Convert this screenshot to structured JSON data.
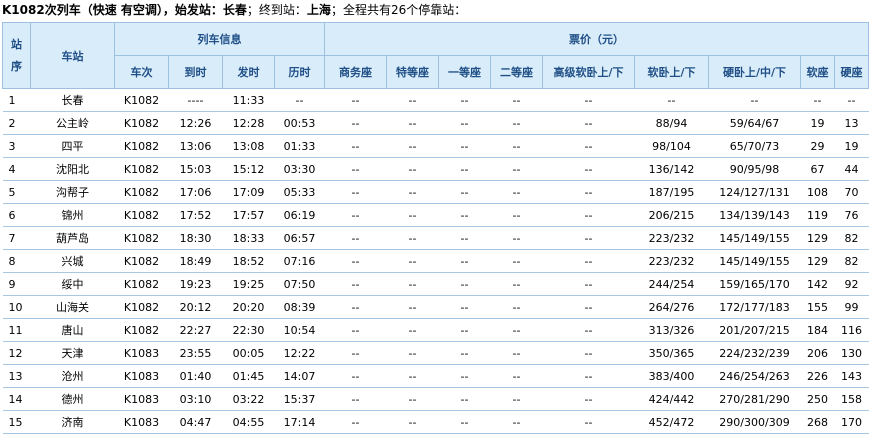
{
  "header": {
    "train_label": "K1082次列车（快速 有空调），始发站：",
    "origin": "长春",
    "terminal_label": "；终到站：",
    "terminal": "上海",
    "summary": "；全程共有26个停靠站："
  },
  "columns": {
    "seq": "站序",
    "station": "车站",
    "train_info": "列车信息",
    "fare_group": "票价（元）",
    "train_no": "车次",
    "arrive": "到时",
    "depart": "发时",
    "duration": "历时",
    "business": "商务座",
    "special": "特等座",
    "first": "一等座",
    "second": "二等座",
    "deluxe_sleeper": "高级软卧上/下",
    "soft_sleeper": "软卧上/下",
    "hard_sleeper": "硬卧上/中/下",
    "soft_seat": "软座",
    "hard_seat": "硬座"
  },
  "rows": [
    [
      "1",
      "长春",
      "K1082",
      "----",
      "11:33",
      "--",
      "--",
      "--",
      "--",
      "--",
      "--",
      "--",
      "--",
      "--",
      "--"
    ],
    [
      "2",
      "公主岭",
      "K1082",
      "12:26",
      "12:28",
      "00:53",
      "--",
      "--",
      "--",
      "--",
      "--",
      "88/94",
      "59/64/67",
      "19",
      "13"
    ],
    [
      "3",
      "四平",
      "K1082",
      "13:06",
      "13:08",
      "01:33",
      "--",
      "--",
      "--",
      "--",
      "--",
      "98/104",
      "65/70/73",
      "29",
      "19"
    ],
    [
      "4",
      "沈阳北",
      "K1082",
      "15:03",
      "15:12",
      "03:30",
      "--",
      "--",
      "--",
      "--",
      "--",
      "136/142",
      "90/95/98",
      "67",
      "44"
    ],
    [
      "5",
      "沟帮子",
      "K1082",
      "17:06",
      "17:09",
      "05:33",
      "--",
      "--",
      "--",
      "--",
      "--",
      "187/195",
      "124/127/131",
      "108",
      "70"
    ],
    [
      "6",
      "锦州",
      "K1082",
      "17:52",
      "17:57",
      "06:19",
      "--",
      "--",
      "--",
      "--",
      "--",
      "206/215",
      "134/139/143",
      "119",
      "76"
    ],
    [
      "7",
      "葫芦岛",
      "K1082",
      "18:30",
      "18:33",
      "06:57",
      "--",
      "--",
      "--",
      "--",
      "--",
      "223/232",
      "145/149/155",
      "129",
      "82"
    ],
    [
      "8",
      "兴城",
      "K1082",
      "18:49",
      "18:52",
      "07:16",
      "--",
      "--",
      "--",
      "--",
      "--",
      "223/232",
      "145/149/155",
      "129",
      "82"
    ],
    [
      "9",
      "绥中",
      "K1082",
      "19:23",
      "19:25",
      "07:50",
      "--",
      "--",
      "--",
      "--",
      "--",
      "244/254",
      "159/165/170",
      "142",
      "92"
    ],
    [
      "10",
      "山海关",
      "K1082",
      "20:12",
      "20:20",
      "08:39",
      "--",
      "--",
      "--",
      "--",
      "--",
      "264/276",
      "172/177/183",
      "155",
      "99"
    ],
    [
      "11",
      "唐山",
      "K1082",
      "22:27",
      "22:30",
      "10:54",
      "--",
      "--",
      "--",
      "--",
      "--",
      "313/326",
      "201/207/215",
      "184",
      "116"
    ],
    [
      "12",
      "天津",
      "K1083",
      "23:55",
      "00:05",
      "12:22",
      "--",
      "--",
      "--",
      "--",
      "--",
      "350/365",
      "224/232/239",
      "206",
      "130"
    ],
    [
      "13",
      "沧州",
      "K1083",
      "01:40",
      "01:45",
      "14:07",
      "--",
      "--",
      "--",
      "--",
      "--",
      "383/400",
      "246/254/263",
      "226",
      "143"
    ],
    [
      "14",
      "德州",
      "K1083",
      "03:10",
      "03:22",
      "15:37",
      "--",
      "--",
      "--",
      "--",
      "--",
      "424/442",
      "270/281/290",
      "250",
      "158"
    ],
    [
      "15",
      "济南",
      "K1083",
      "04:47",
      "04:55",
      "17:14",
      "--",
      "--",
      "--",
      "--",
      "--",
      "452/472",
      "290/300/309",
      "268",
      "170"
    ]
  ]
}
